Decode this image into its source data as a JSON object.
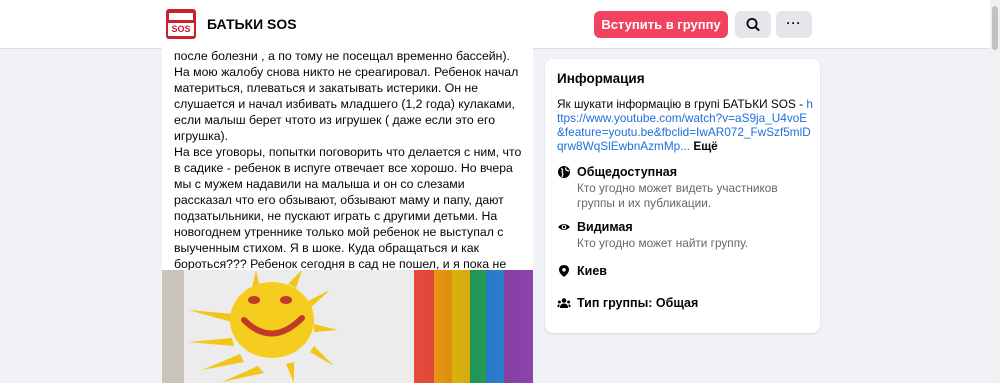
{
  "header": {
    "group_name": "БАТЬКИ SOS",
    "logo_text": "SOS",
    "join_label": "Вступить в группу",
    "search_icon": "search-icon",
    "more_icon_text": "···",
    "accent_color": "#f3425f"
  },
  "post": {
    "cut_line": "...",
    "paragraph1": "после болезни , а по тому не посещал временно бассейн). На мою жалобу снова никто не среагировал. Ребенок начал материться, плеваться и закатывать истерики. Он не слушается и начал избивать младшего (1,2 года) кулаками, если малыш берет чтото из игрушек ( даже если это его игрушка).",
    "paragraph2": "На все уговоры, попытки поговорить что делается с ним, что в садике - ребенок в испуге отвечает все хорошо. Но вчера мы с мужем надавили на малыша и он со слезами рассказал что его обзывают, обзывают маму и папу, дают подзатыльники, не пускают играть с другими детьми. На новогоднем утреннике только мой ребенок не выступал с выученным стихом. Я в шоке. Куда обращаться и как бороться??? Ребенок сегодня в сад не пошел, и я пока не разберусь он останется дома, но я в растерянности как дейстовать?! Как помочь выйти из этой травмы без последствий? Как наказать виновных"
  },
  "info": {
    "title": "Информация",
    "desc_text": "Як шукати інформацію в групі БАТЬКИ SOS - ",
    "desc_link": "https://www.youtube.com/watch?v=aS9ja_U4voE&feature=youtu.be&fbclid=IwAR072_FwSzf5mlDqrw8WqSlEwbnAzmMp...",
    "desc_more": "Ещё",
    "public_title": "Общедоступная",
    "public_sub": "Кто угодно может видеть участников группы и их публикации.",
    "visible_title": "Видимая",
    "visible_sub": "Кто угодно может найти группу.",
    "location": "Киев",
    "group_type": "Тип группы: Общая"
  }
}
